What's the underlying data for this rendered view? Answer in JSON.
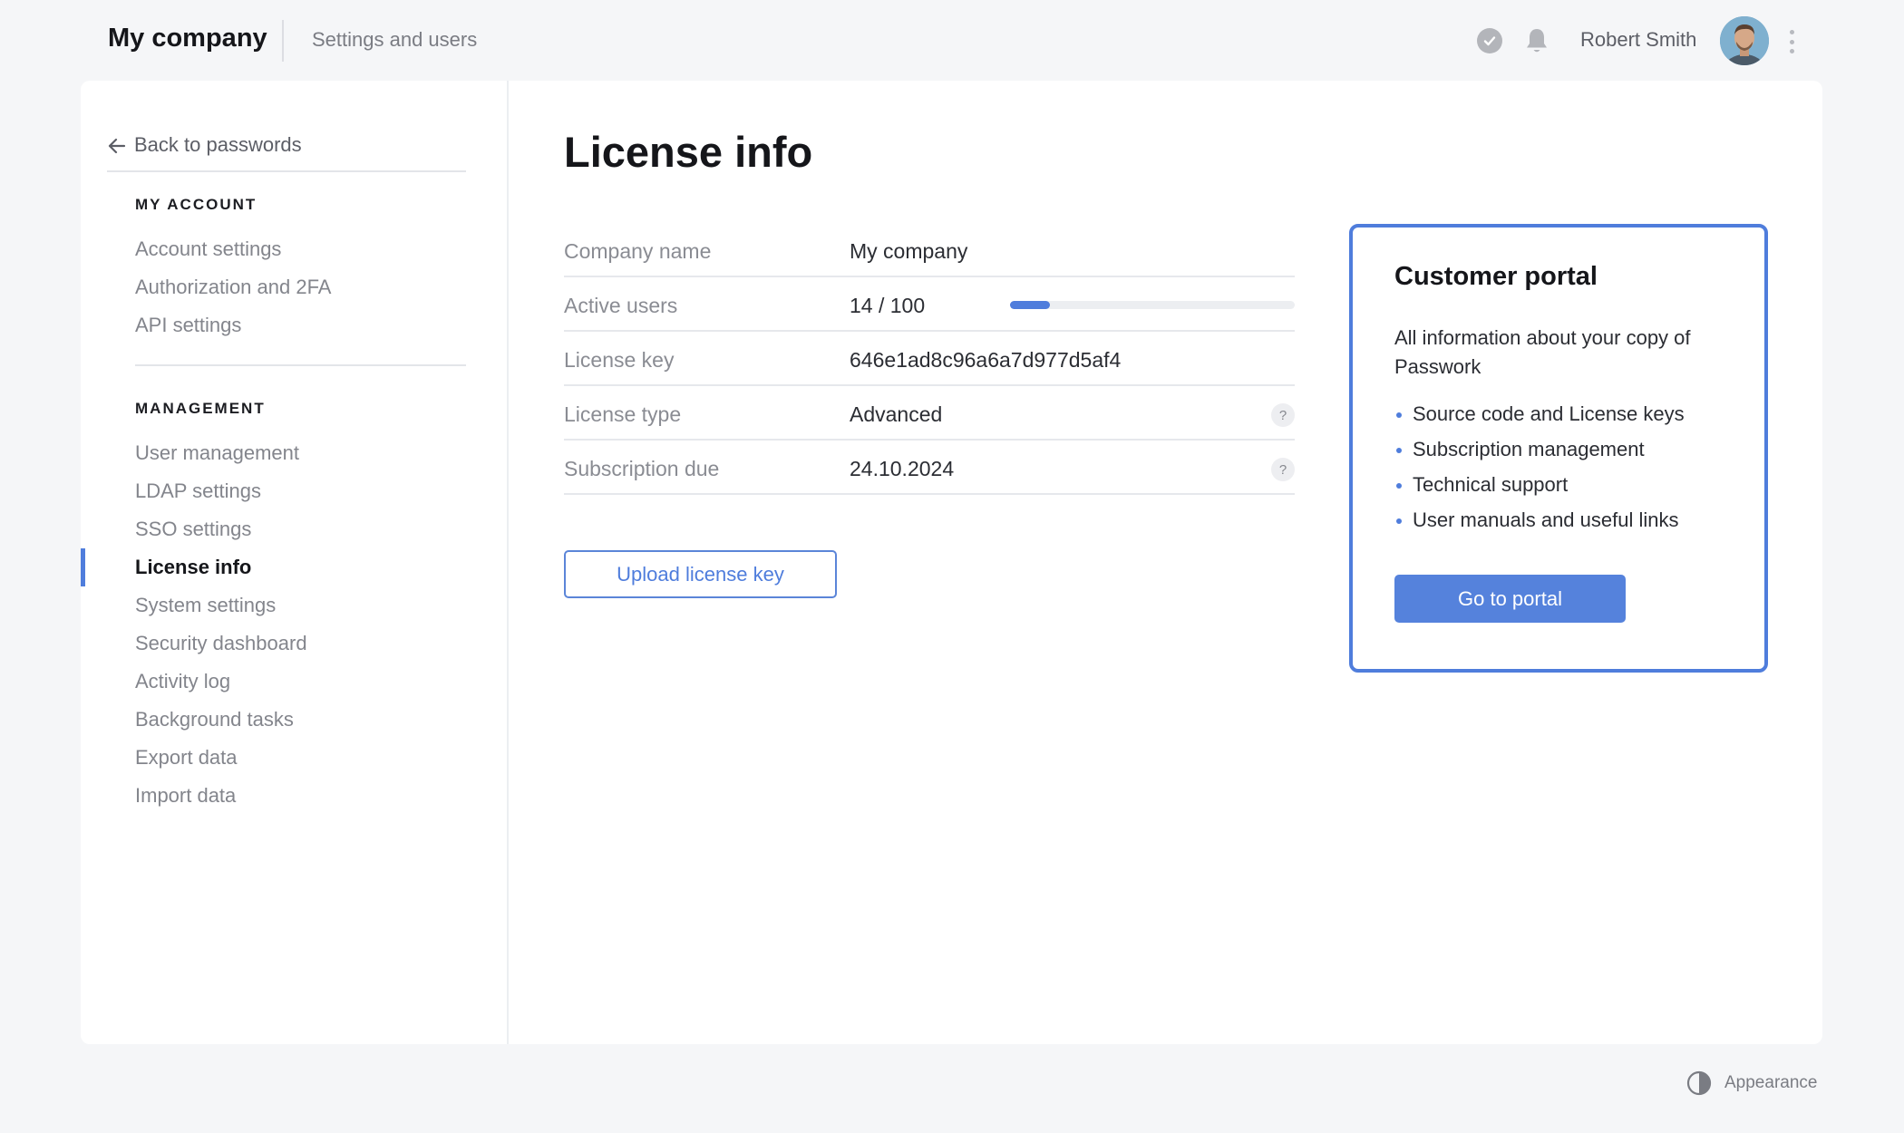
{
  "header": {
    "company": "My company",
    "subtitle": "Settings and users",
    "user_name": "Robert Smith",
    "icons": [
      "check-circle-icon",
      "bell-icon",
      "more-vertical-icon"
    ]
  },
  "sidebar": {
    "back_label": "Back to passwords",
    "sections": [
      {
        "title": "MY ACCOUNT",
        "items": [
          "Account settings",
          "Authorization and 2FA",
          "API settings"
        ]
      },
      {
        "title": "MANAGEMENT",
        "items": [
          "User management",
          "LDAP settings",
          "SSO settings",
          "License info",
          "System settings",
          "Security dashboard",
          "Activity log",
          "Background tasks",
          "Export data",
          "Import data"
        ]
      }
    ],
    "active_item": "License info"
  },
  "main": {
    "title": "License info",
    "rows": [
      {
        "label": "Company name",
        "value": "My company"
      },
      {
        "label": "Active users",
        "value": "14 / 100",
        "progress": 0.14
      },
      {
        "label": "License key",
        "value": "646e1ad8c96a6a7d977d5af4"
      },
      {
        "label": "License type",
        "value": "Advanced",
        "help": "?"
      },
      {
        "label": "Subscription due",
        "value": "24.10.2024",
        "help": "?"
      }
    ],
    "upload_button": "Upload license key"
  },
  "portal": {
    "title": "Customer portal",
    "description": "All information about your copy of Passwork",
    "features": [
      "Source code and License keys",
      "Subscription management",
      "Technical support",
      "User manuals and useful links"
    ],
    "button": "Go to portal"
  },
  "footer": {
    "appearance_label": "Appearance"
  },
  "colors": {
    "accent": "#4f7ddc",
    "background": "#f5f6f8",
    "card": "#ffffff"
  }
}
